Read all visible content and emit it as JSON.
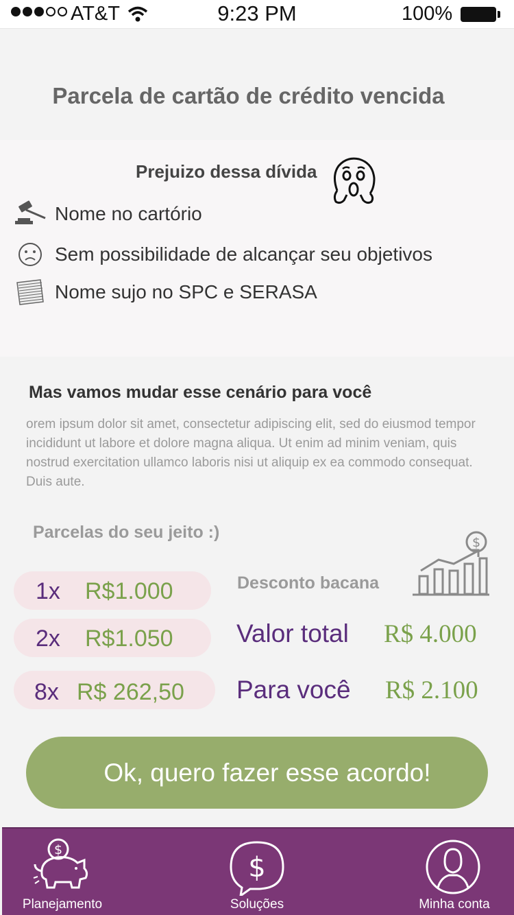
{
  "status_bar": {
    "carrier": "AT&T",
    "time": "9:23 PM",
    "battery": "100%"
  },
  "page": {
    "title": "Parcela de cartão de crédito vencida"
  },
  "losses": {
    "heading": "Prejuizo dessa dívida",
    "items": [
      {
        "label": "Nome no cartório",
        "icon": "gavel-icon"
      },
      {
        "label": "Sem possibilidade de alcançar seu objetivos",
        "icon": "sad-face-icon"
      },
      {
        "label": "Nome sujo no SPC e SERASA",
        "icon": "papers-icon"
      }
    ]
  },
  "change": {
    "heading": "Mas vamos mudar esse cenário para você",
    "body": "orem ipsum dolor sit amet, consectetur adipiscing elit, sed do eiusmod tempor incididunt ut labore et dolore magna aliqua. Ut enim ad minim veniam, quis nostrud exercitation ullamco laboris nisi ut aliquip ex ea commodo consequat. Duis aute."
  },
  "installments": {
    "heading": "Parcelas do seu jeito :)",
    "options": [
      {
        "times": "1x",
        "amount": "R$1.000"
      },
      {
        "times": "2x",
        "amount": "R$1.050"
      },
      {
        "times": "8x",
        "amount": "R$ 262,50"
      }
    ]
  },
  "summary": {
    "discount_label": "Desconto bacana",
    "total_label": "Valor total",
    "total_value": "R$ 4.000",
    "you_label": "Para você",
    "you_value": "R$ 2.100"
  },
  "cta": {
    "label": "Ok, quero fazer esse acordo!"
  },
  "tab_bar": {
    "tabs": [
      {
        "label": "Planejamento",
        "icon": "piggy-bank-icon"
      },
      {
        "label": "Soluções",
        "icon": "dollar-chat-icon"
      },
      {
        "label": "Minha conta",
        "icon": "user-icon"
      }
    ]
  },
  "colors": {
    "purple": "#7b3776",
    "purple_text": "#5a2d7c",
    "green": "#7aa14b",
    "cta_green": "#97ad6c",
    "pill_pink": "#f5e5e8"
  }
}
